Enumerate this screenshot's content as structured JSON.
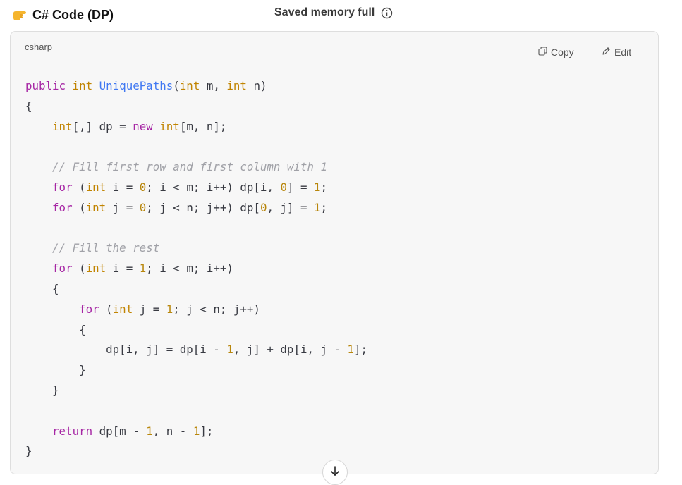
{
  "header": {
    "icon": "pointing-hand-emoji",
    "title": "C# Code (DP)",
    "memory_status": "Saved memory full",
    "memory_info_icon": "info-icon"
  },
  "code_block": {
    "language": "csharp",
    "copy_label": "Copy",
    "edit_label": "Edit",
    "lines": [
      [
        {
          "t": "kw",
          "v": "public"
        },
        {
          "t": "p",
          "v": " "
        },
        {
          "t": "ty",
          "v": "int"
        },
        {
          "t": "p",
          "v": " "
        },
        {
          "t": "fn",
          "v": "UniquePaths"
        },
        {
          "t": "p",
          "v": "("
        },
        {
          "t": "ty",
          "v": "int"
        },
        {
          "t": "p",
          "v": " m, "
        },
        {
          "t": "ty",
          "v": "int"
        },
        {
          "t": "p",
          "v": " n)"
        }
      ],
      [
        {
          "t": "p",
          "v": "{"
        }
      ],
      [
        {
          "t": "p",
          "v": "    "
        },
        {
          "t": "ty",
          "v": "int"
        },
        {
          "t": "p",
          "v": "[,] dp = "
        },
        {
          "t": "kw",
          "v": "new"
        },
        {
          "t": "p",
          "v": " "
        },
        {
          "t": "ty",
          "v": "int"
        },
        {
          "t": "p",
          "v": "[m, n];"
        }
      ],
      [],
      [
        {
          "t": "p",
          "v": "    "
        },
        {
          "t": "cm",
          "v": "// Fill first row and first column with 1"
        }
      ],
      [
        {
          "t": "p",
          "v": "    "
        },
        {
          "t": "kw",
          "v": "for"
        },
        {
          "t": "p",
          "v": " ("
        },
        {
          "t": "ty",
          "v": "int"
        },
        {
          "t": "p",
          "v": " i = "
        },
        {
          "t": "nu",
          "v": "0"
        },
        {
          "t": "p",
          "v": "; i < m; i++) dp[i, "
        },
        {
          "t": "nu",
          "v": "0"
        },
        {
          "t": "p",
          "v": "] = "
        },
        {
          "t": "nu",
          "v": "1"
        },
        {
          "t": "p",
          "v": ";"
        }
      ],
      [
        {
          "t": "p",
          "v": "    "
        },
        {
          "t": "kw",
          "v": "for"
        },
        {
          "t": "p",
          "v": " ("
        },
        {
          "t": "ty",
          "v": "int"
        },
        {
          "t": "p",
          "v": " j = "
        },
        {
          "t": "nu",
          "v": "0"
        },
        {
          "t": "p",
          "v": "; j < n; j++) dp["
        },
        {
          "t": "nu",
          "v": "0"
        },
        {
          "t": "p",
          "v": ", j] = "
        },
        {
          "t": "nu",
          "v": "1"
        },
        {
          "t": "p",
          "v": ";"
        }
      ],
      [],
      [
        {
          "t": "p",
          "v": "    "
        },
        {
          "t": "cm",
          "v": "// Fill the rest"
        }
      ],
      [
        {
          "t": "p",
          "v": "    "
        },
        {
          "t": "kw",
          "v": "for"
        },
        {
          "t": "p",
          "v": " ("
        },
        {
          "t": "ty",
          "v": "int"
        },
        {
          "t": "p",
          "v": " i = "
        },
        {
          "t": "nu",
          "v": "1"
        },
        {
          "t": "p",
          "v": "; i < m; i++)"
        }
      ],
      [
        {
          "t": "p",
          "v": "    {"
        }
      ],
      [
        {
          "t": "p",
          "v": "        "
        },
        {
          "t": "kw",
          "v": "for"
        },
        {
          "t": "p",
          "v": " ("
        },
        {
          "t": "ty",
          "v": "int"
        },
        {
          "t": "p",
          "v": " j = "
        },
        {
          "t": "nu",
          "v": "1"
        },
        {
          "t": "p",
          "v": "; j < n; j++)"
        }
      ],
      [
        {
          "t": "p",
          "v": "        {"
        }
      ],
      [
        {
          "t": "p",
          "v": "            dp[i, j] = dp[i - "
        },
        {
          "t": "nu",
          "v": "1"
        },
        {
          "t": "p",
          "v": ", j] + dp[i, j - "
        },
        {
          "t": "nu",
          "v": "1"
        },
        {
          "t": "p",
          "v": "];"
        }
      ],
      [
        {
          "t": "p",
          "v": "        }"
        }
      ],
      [
        {
          "t": "p",
          "v": "    }"
        }
      ],
      [],
      [
        {
          "t": "p",
          "v": "    "
        },
        {
          "t": "kw",
          "v": "return"
        },
        {
          "t": "p",
          "v": " dp[m - "
        },
        {
          "t": "nu",
          "v": "1"
        },
        {
          "t": "p",
          "v": ", n - "
        },
        {
          "t": "nu",
          "v": "1"
        },
        {
          "t": "p",
          "v": "];"
        }
      ],
      [
        {
          "t": "p",
          "v": "}"
        }
      ]
    ]
  },
  "scroll_down_icon": "arrow-down-icon",
  "colors": {
    "keyword": "#a626a4",
    "type": "#c18401",
    "function": "#4078f2",
    "number": "#b8860b",
    "comment": "#a0a1a7",
    "code_background": "#f7f7f7"
  }
}
